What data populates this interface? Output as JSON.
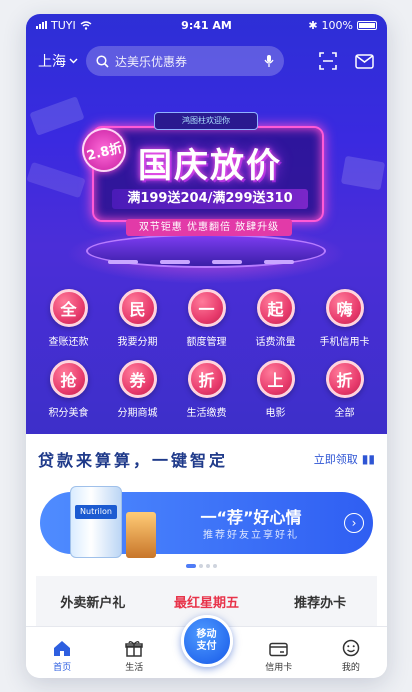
{
  "status": {
    "carrier": "TUYI",
    "time": "9:41 AM",
    "battery": "100%"
  },
  "header": {
    "city": "上海",
    "search_placeholder": "达美乐优惠券"
  },
  "banner": {
    "sign": "鸿图柱欢迎你",
    "discount": "2.8折",
    "headline": "国庆放价",
    "promo": "满199送204/满299送310",
    "slogan": "双节钜惠 优惠翻倍 放肆升级"
  },
  "grid": [
    {
      "glyph": "全",
      "label": "查账还款"
    },
    {
      "glyph": "民",
      "label": "我要分期"
    },
    {
      "glyph": "一",
      "label": "额度管理"
    },
    {
      "glyph": "起",
      "label": "话费流量"
    },
    {
      "glyph": "嗨",
      "label": "手机信用卡"
    },
    {
      "glyph": "抢",
      "label": "积分美食"
    },
    {
      "glyph": "券",
      "label": "分期商城"
    },
    {
      "glyph": "折",
      "label": "生活缴费"
    },
    {
      "glyph": "上",
      "label": "电影"
    },
    {
      "glyph": "折",
      "label": "全部"
    }
  ],
  "notice": {
    "text": "贷款来算算，一键智定",
    "link": "立即领取"
  },
  "card": {
    "title": "一“荐”好心情",
    "subtitle": "推荐好友立享好礼",
    "can_label": "Nutrilon"
  },
  "tri": [
    "外卖新户礼",
    "最红星期五",
    "推荐办卡"
  ],
  "tabbar": {
    "home": "首页",
    "life": "生活",
    "fab": "移动\n支付",
    "card": "信用卡",
    "mine": "我的"
  },
  "colors": {
    "primary": "#2e5fe0",
    "accent_red": "#e8334a",
    "banner_bg": "#3a2ae0"
  }
}
